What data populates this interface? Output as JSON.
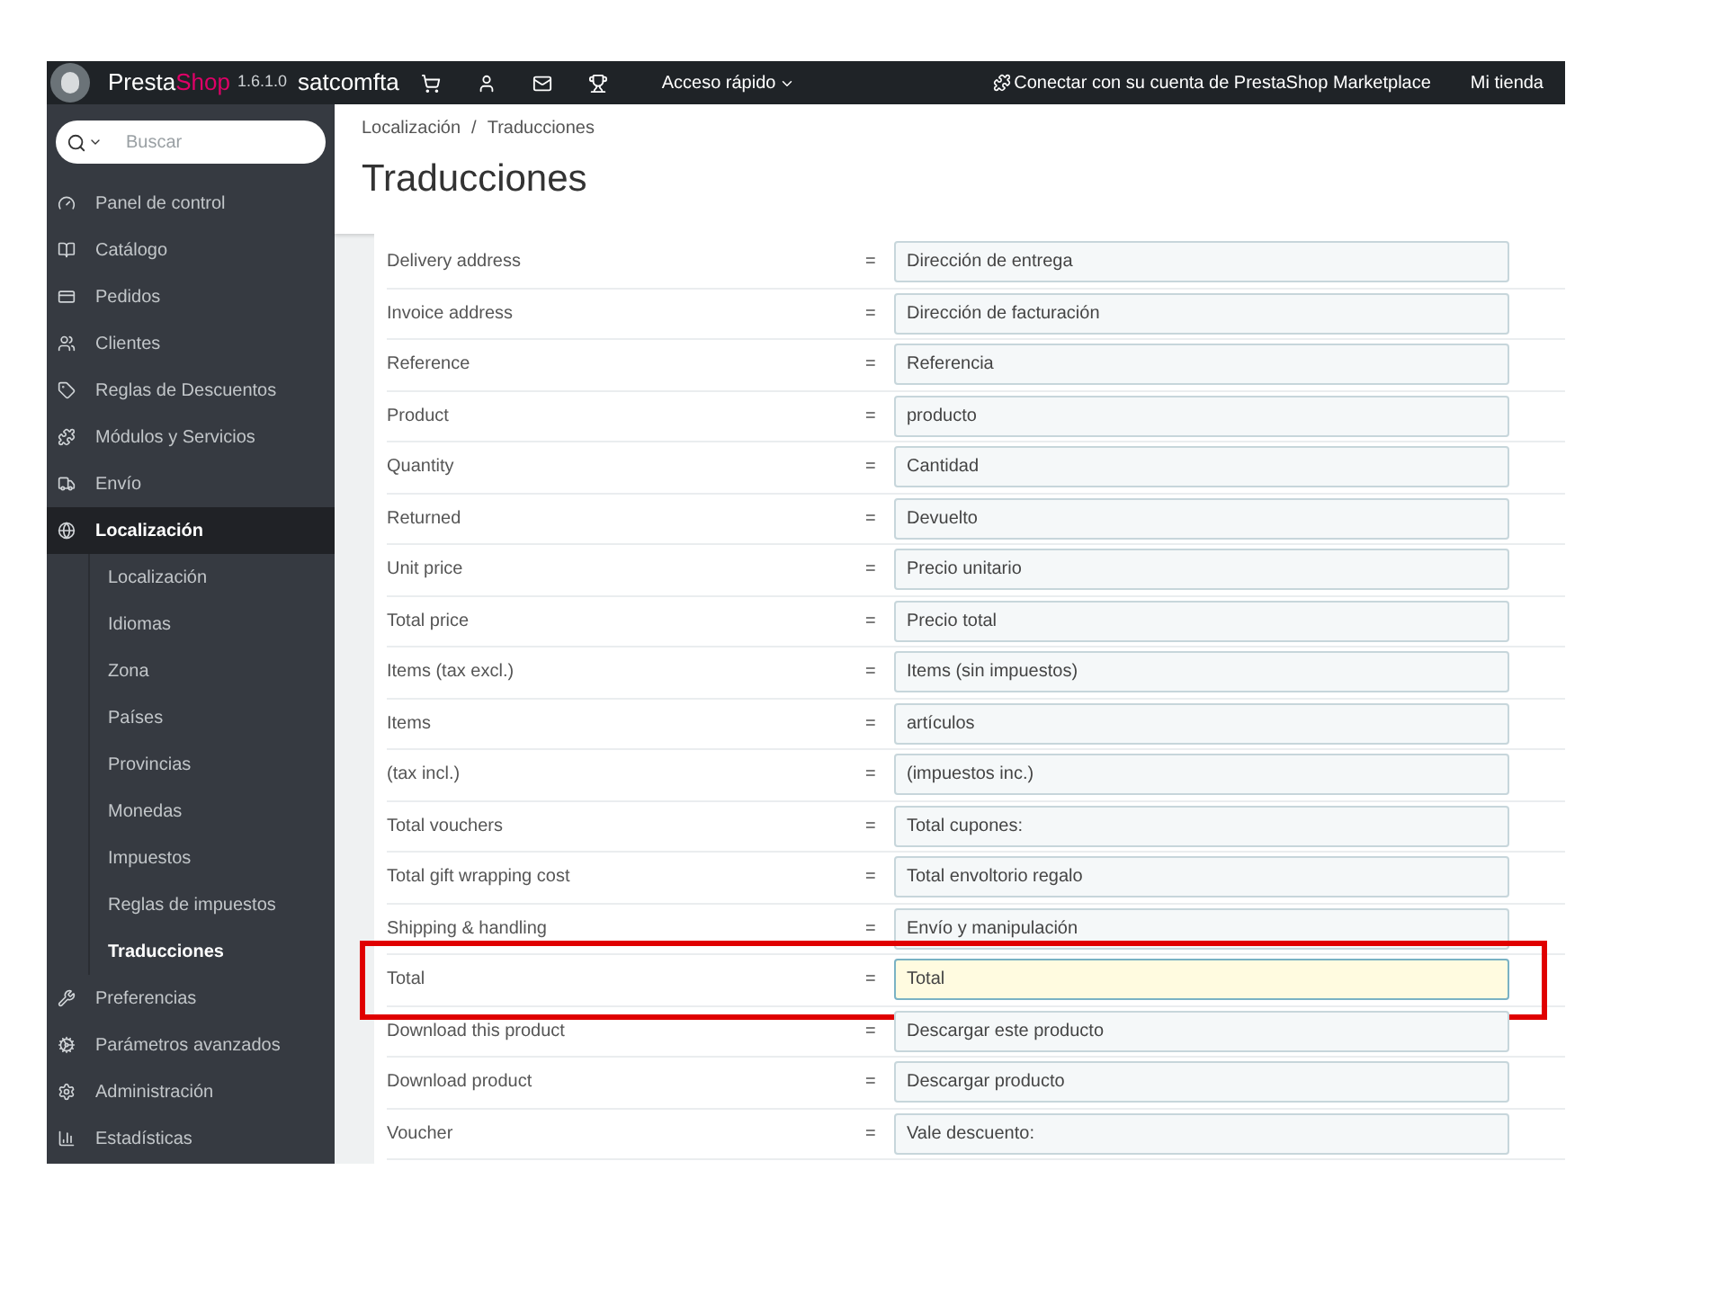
{
  "topbar": {
    "brand_first": "Presta",
    "brand_second": "Shop",
    "version": "1.6.1.0",
    "shop": "satcomfta",
    "quick_access": "Acceso rápido",
    "connect": "Conectar con su cuenta de PrestaShop Marketplace",
    "my_shop": "Mi tienda"
  },
  "sidebar": {
    "search": {
      "placeholder": "Buscar"
    },
    "items": [
      {
        "kind": "dashboard",
        "label": "Panel de control",
        "selected": false
      },
      {
        "kind": "catalog",
        "label": "Catálogo",
        "selected": false
      },
      {
        "kind": "orders",
        "label": "Pedidos",
        "selected": false
      },
      {
        "kind": "customers",
        "label": "Clientes",
        "selected": false
      },
      {
        "kind": "discounts",
        "label": "Reglas de Descuentos",
        "selected": false
      },
      {
        "kind": "modules",
        "label": "Módulos y Servicios",
        "selected": false
      },
      {
        "kind": "shipping",
        "label": "Envío",
        "selected": false
      },
      {
        "kind": "localization",
        "label": "Localización",
        "selected": true,
        "children": [
          {
            "label": "Localización",
            "selected": false
          },
          {
            "label": "Idiomas",
            "selected": false
          },
          {
            "label": "Zona",
            "selected": false
          },
          {
            "label": "Países",
            "selected": false
          },
          {
            "label": "Provincias",
            "selected": false
          },
          {
            "label": "Monedas",
            "selected": false
          },
          {
            "label": "Impuestos",
            "selected": false
          },
          {
            "label": "Reglas de impuestos",
            "selected": false
          },
          {
            "label": "Traducciones",
            "selected": true
          }
        ]
      },
      {
        "kind": "preferences",
        "label": "Preferencias",
        "selected": false
      },
      {
        "kind": "advanced",
        "label": "Parámetros avanzados",
        "selected": false
      },
      {
        "kind": "admin",
        "label": "Administración",
        "selected": false
      },
      {
        "kind": "stats",
        "label": "Estadísticas",
        "selected": false
      }
    ]
  },
  "breadcrumb": [
    "Localización",
    "Traducciones"
  ],
  "breadcrumb_separator": "/",
  "equals_sign": "=",
  "title": "Traducciones",
  "rows": [
    {
      "label": "Delivery address",
      "value": "Dirección de entrega",
      "highlighted": false
    },
    {
      "label": "Invoice address",
      "value": "Dirección de facturación",
      "highlighted": false
    },
    {
      "label": "Reference",
      "value": "Referencia",
      "highlighted": false
    },
    {
      "label": "Product",
      "value": "producto",
      "highlighted": false
    },
    {
      "label": "Quantity",
      "value": "Cantidad",
      "highlighted": false
    },
    {
      "label": "Returned",
      "value": "Devuelto",
      "highlighted": false
    },
    {
      "label": "Unit price",
      "value": "Precio unitario",
      "highlighted": false
    },
    {
      "label": "Total price",
      "value": "Precio total",
      "highlighted": false
    },
    {
      "label": "Items (tax excl.)",
      "value": "Items (sin impuestos)",
      "highlighted": false
    },
    {
      "label": "Items",
      "value": "artículos",
      "highlighted": false
    },
    {
      "label": "(tax incl.)",
      "value": "(impuestos inc.)",
      "highlighted": false
    },
    {
      "label": "Total vouchers",
      "value": "Total cupones:",
      "highlighted": false
    },
    {
      "label": "Total gift wrapping cost",
      "value": "Total envoltorio regalo",
      "highlighted": false
    },
    {
      "label": "Shipping & handling",
      "value": "Envío y manipulación",
      "highlighted": false
    },
    {
      "label": "Total",
      "value": "Total",
      "highlighted": true
    },
    {
      "label": "Download this product",
      "value": "Descargar este producto",
      "highlighted": false
    },
    {
      "label": "Download product",
      "value": "Descargar producto",
      "highlighted": false
    },
    {
      "label": "Voucher",
      "value": "Vale descuento:",
      "highlighted": false
    }
  ]
}
